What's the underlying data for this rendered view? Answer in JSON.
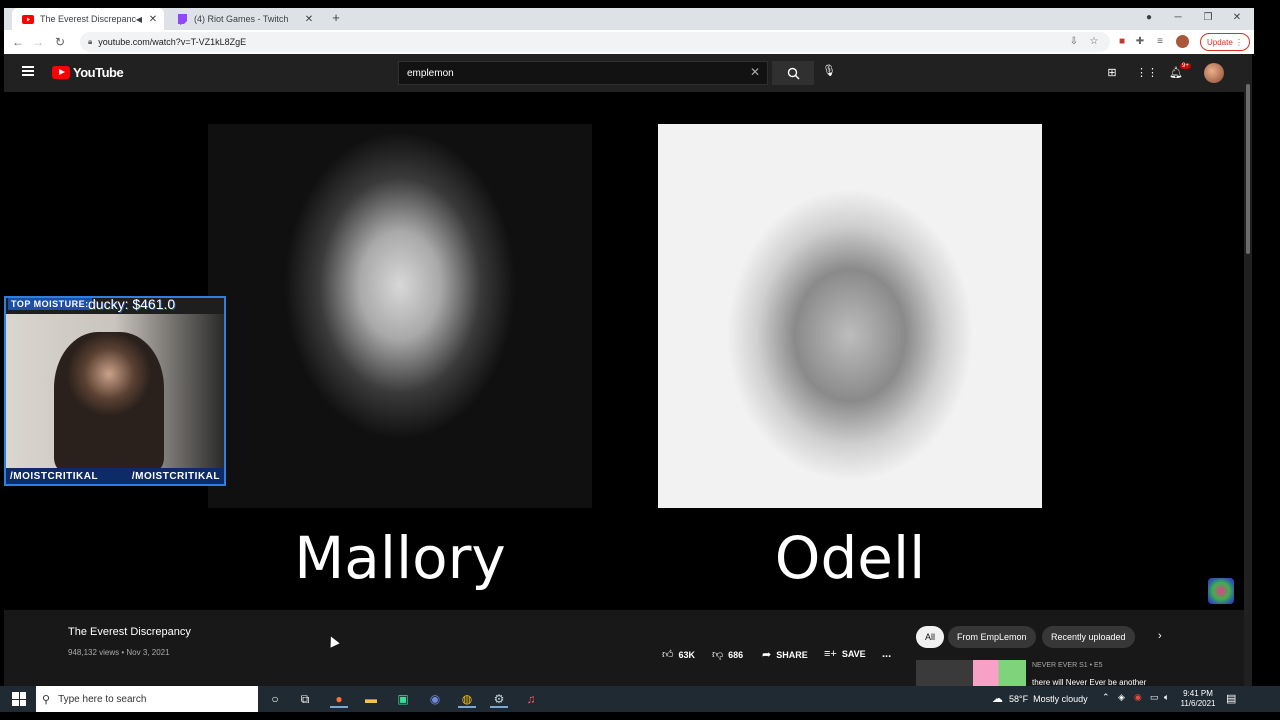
{
  "browser": {
    "tabs": [
      {
        "title": "The Everest Discrepancy - Yo",
        "favicon": "youtube-icon"
      },
      {
        "title": "(4) Riot Games - Twitch",
        "favicon": "twitch-icon"
      }
    ],
    "new_tab": "+",
    "url": "youtube.com/watch?v=T-VZ1kL8ZgE",
    "update_label": "Update"
  },
  "youtube": {
    "logo": "YouTube",
    "search_value": "emplemon",
    "notification_count": "9+",
    "accent_color": "#ff0000"
  },
  "video": {
    "captions": {
      "left": "Mallory",
      "right": "Odell"
    },
    "title": "The Everest Discrepancy",
    "views": "948,132 views",
    "date": "Nov 3, 2021",
    "likes": "63K",
    "dislikes": "686",
    "share_label": "SHARE",
    "save_label": "SAVE",
    "more": "..."
  },
  "overlay": {
    "top_label": "TOP MOISTURE:",
    "top_value": "ducky: $461.0",
    "handle_left": "/MOISTCRITIKAL",
    "handle_right": "/MOISTCRITIKAL",
    "border_color": "#2d7fe0"
  },
  "recommendations": {
    "chips": [
      "All",
      "From EmpLemon",
      "Recently uploaded"
    ],
    "next": "›",
    "first_item_channel": "NEVER EVER  S1 • E5",
    "first_item_title": "there will Never Ever be another"
  },
  "taskbar": {
    "search_placeholder": "Type here to search",
    "temperature": "58°F",
    "weather": "Mostly cloudy",
    "time": "9:41 PM",
    "date": "11/6/2021"
  }
}
